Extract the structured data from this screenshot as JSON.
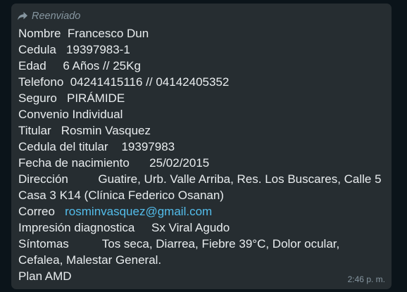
{
  "message": {
    "forwarded_label": "Reenviado",
    "lines": [
      "Nombre  Francesco Dun",
      "Cedula   19397983-1",
      "Edad     6 Años // 25Kg",
      "Telefono  04241415116 // 04142405352",
      "Seguro   PIRÁMIDE",
      "Convenio Individual",
      "Titular   Rosmin Vasquez",
      "Cedula del titular    19397983",
      "Fecha de nacimiento      25/02/2015",
      "Dirección         Guatire, Urb. Valle Arriba, Res. Los Buscares, Calle 5 Casa 3 K14 (Clínica Federico Osanan)"
    ],
    "email_label": "Correo   ",
    "email_value": "rosminvasquez@gmail.com",
    "lines_after": [
      "Impresión diagnostica     Sx Viral Agudo",
      "Síntomas          Tos seca, Diarrea, Fiebre 39°C, Dolor ocular, Cefalea, Malestar General.",
      "Plan AMD"
    ],
    "time": "2:46 p. m."
  }
}
